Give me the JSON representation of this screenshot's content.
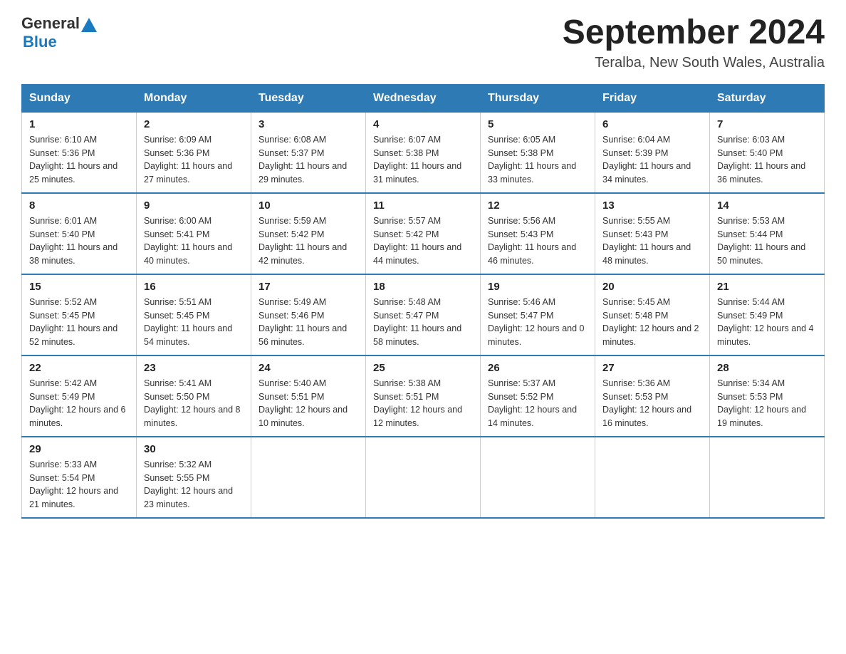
{
  "header": {
    "logo_general": "General",
    "logo_blue": "Blue",
    "title": "September 2024",
    "subtitle": "Teralba, New South Wales, Australia"
  },
  "days_of_week": [
    "Sunday",
    "Monday",
    "Tuesday",
    "Wednesday",
    "Thursday",
    "Friday",
    "Saturday"
  ],
  "weeks": [
    [
      {
        "day": "1",
        "sunrise": "Sunrise: 6:10 AM",
        "sunset": "Sunset: 5:36 PM",
        "daylight": "Daylight: 11 hours and 25 minutes."
      },
      {
        "day": "2",
        "sunrise": "Sunrise: 6:09 AM",
        "sunset": "Sunset: 5:36 PM",
        "daylight": "Daylight: 11 hours and 27 minutes."
      },
      {
        "day": "3",
        "sunrise": "Sunrise: 6:08 AM",
        "sunset": "Sunset: 5:37 PM",
        "daylight": "Daylight: 11 hours and 29 minutes."
      },
      {
        "day": "4",
        "sunrise": "Sunrise: 6:07 AM",
        "sunset": "Sunset: 5:38 PM",
        "daylight": "Daylight: 11 hours and 31 minutes."
      },
      {
        "day": "5",
        "sunrise": "Sunrise: 6:05 AM",
        "sunset": "Sunset: 5:38 PM",
        "daylight": "Daylight: 11 hours and 33 minutes."
      },
      {
        "day": "6",
        "sunrise": "Sunrise: 6:04 AM",
        "sunset": "Sunset: 5:39 PM",
        "daylight": "Daylight: 11 hours and 34 minutes."
      },
      {
        "day": "7",
        "sunrise": "Sunrise: 6:03 AM",
        "sunset": "Sunset: 5:40 PM",
        "daylight": "Daylight: 11 hours and 36 minutes."
      }
    ],
    [
      {
        "day": "8",
        "sunrise": "Sunrise: 6:01 AM",
        "sunset": "Sunset: 5:40 PM",
        "daylight": "Daylight: 11 hours and 38 minutes."
      },
      {
        "day": "9",
        "sunrise": "Sunrise: 6:00 AM",
        "sunset": "Sunset: 5:41 PM",
        "daylight": "Daylight: 11 hours and 40 minutes."
      },
      {
        "day": "10",
        "sunrise": "Sunrise: 5:59 AM",
        "sunset": "Sunset: 5:42 PM",
        "daylight": "Daylight: 11 hours and 42 minutes."
      },
      {
        "day": "11",
        "sunrise": "Sunrise: 5:57 AM",
        "sunset": "Sunset: 5:42 PM",
        "daylight": "Daylight: 11 hours and 44 minutes."
      },
      {
        "day": "12",
        "sunrise": "Sunrise: 5:56 AM",
        "sunset": "Sunset: 5:43 PM",
        "daylight": "Daylight: 11 hours and 46 minutes."
      },
      {
        "day": "13",
        "sunrise": "Sunrise: 5:55 AM",
        "sunset": "Sunset: 5:43 PM",
        "daylight": "Daylight: 11 hours and 48 minutes."
      },
      {
        "day": "14",
        "sunrise": "Sunrise: 5:53 AM",
        "sunset": "Sunset: 5:44 PM",
        "daylight": "Daylight: 11 hours and 50 minutes."
      }
    ],
    [
      {
        "day": "15",
        "sunrise": "Sunrise: 5:52 AM",
        "sunset": "Sunset: 5:45 PM",
        "daylight": "Daylight: 11 hours and 52 minutes."
      },
      {
        "day": "16",
        "sunrise": "Sunrise: 5:51 AM",
        "sunset": "Sunset: 5:45 PM",
        "daylight": "Daylight: 11 hours and 54 minutes."
      },
      {
        "day": "17",
        "sunrise": "Sunrise: 5:49 AM",
        "sunset": "Sunset: 5:46 PM",
        "daylight": "Daylight: 11 hours and 56 minutes."
      },
      {
        "day": "18",
        "sunrise": "Sunrise: 5:48 AM",
        "sunset": "Sunset: 5:47 PM",
        "daylight": "Daylight: 11 hours and 58 minutes."
      },
      {
        "day": "19",
        "sunrise": "Sunrise: 5:46 AM",
        "sunset": "Sunset: 5:47 PM",
        "daylight": "Daylight: 12 hours and 0 minutes."
      },
      {
        "day": "20",
        "sunrise": "Sunrise: 5:45 AM",
        "sunset": "Sunset: 5:48 PM",
        "daylight": "Daylight: 12 hours and 2 minutes."
      },
      {
        "day": "21",
        "sunrise": "Sunrise: 5:44 AM",
        "sunset": "Sunset: 5:49 PM",
        "daylight": "Daylight: 12 hours and 4 minutes."
      }
    ],
    [
      {
        "day": "22",
        "sunrise": "Sunrise: 5:42 AM",
        "sunset": "Sunset: 5:49 PM",
        "daylight": "Daylight: 12 hours and 6 minutes."
      },
      {
        "day": "23",
        "sunrise": "Sunrise: 5:41 AM",
        "sunset": "Sunset: 5:50 PM",
        "daylight": "Daylight: 12 hours and 8 minutes."
      },
      {
        "day": "24",
        "sunrise": "Sunrise: 5:40 AM",
        "sunset": "Sunset: 5:51 PM",
        "daylight": "Daylight: 12 hours and 10 minutes."
      },
      {
        "day": "25",
        "sunrise": "Sunrise: 5:38 AM",
        "sunset": "Sunset: 5:51 PM",
        "daylight": "Daylight: 12 hours and 12 minutes."
      },
      {
        "day": "26",
        "sunrise": "Sunrise: 5:37 AM",
        "sunset": "Sunset: 5:52 PM",
        "daylight": "Daylight: 12 hours and 14 minutes."
      },
      {
        "day": "27",
        "sunrise": "Sunrise: 5:36 AM",
        "sunset": "Sunset: 5:53 PM",
        "daylight": "Daylight: 12 hours and 16 minutes."
      },
      {
        "day": "28",
        "sunrise": "Sunrise: 5:34 AM",
        "sunset": "Sunset: 5:53 PM",
        "daylight": "Daylight: 12 hours and 19 minutes."
      }
    ],
    [
      {
        "day": "29",
        "sunrise": "Sunrise: 5:33 AM",
        "sunset": "Sunset: 5:54 PM",
        "daylight": "Daylight: 12 hours and 21 minutes."
      },
      {
        "day": "30",
        "sunrise": "Sunrise: 5:32 AM",
        "sunset": "Sunset: 5:55 PM",
        "daylight": "Daylight: 12 hours and 23 minutes."
      },
      null,
      null,
      null,
      null,
      null
    ]
  ]
}
